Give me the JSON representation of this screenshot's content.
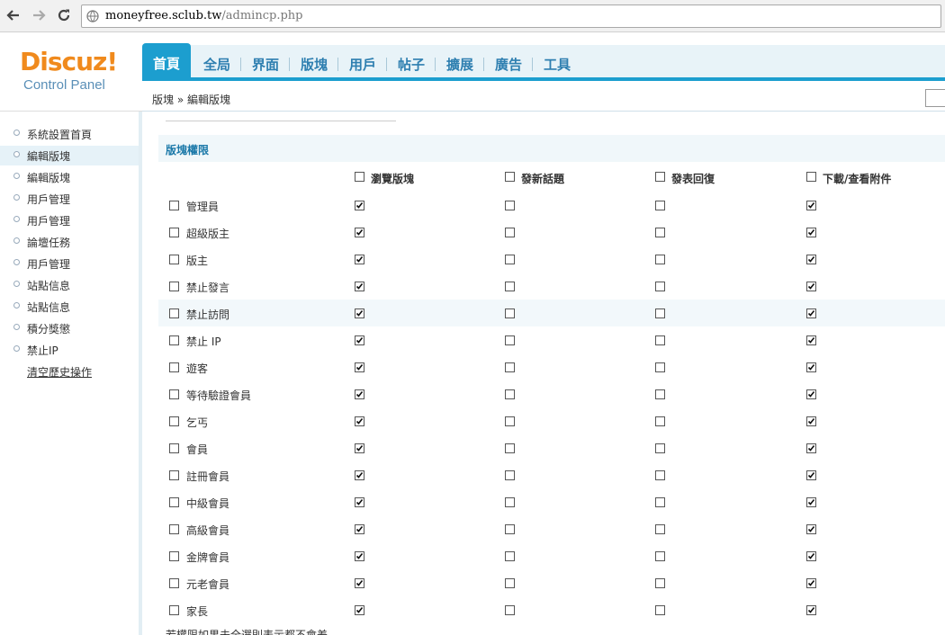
{
  "browser": {
    "url_host": "moneyfree.sclub.tw",
    "url_path": "/admincp.php"
  },
  "logo": {
    "brand": "Discuz!",
    "subtitle": "Control Panel"
  },
  "topnav": [
    {
      "label": "首頁",
      "active": true
    },
    {
      "label": "全局",
      "active": false
    },
    {
      "label": "界面",
      "active": false
    },
    {
      "label": "版塊",
      "active": false
    },
    {
      "label": "用戶",
      "active": false
    },
    {
      "label": "帖子",
      "active": false
    },
    {
      "label": "擴展",
      "active": false
    },
    {
      "label": "廣告",
      "active": false
    },
    {
      "label": "工具",
      "active": false
    }
  ],
  "breadcrumb": "版塊 » 編輯版塊",
  "sidebar": [
    {
      "label": "系統設置首頁",
      "active": false,
      "link": false
    },
    {
      "label": "編輯版塊",
      "active": true,
      "link": false
    },
    {
      "label": "編輯版塊",
      "active": false,
      "link": false
    },
    {
      "label": "用戶管理",
      "active": false,
      "link": false
    },
    {
      "label": "用戶管理",
      "active": false,
      "link": false
    },
    {
      "label": "論壇任務",
      "active": false,
      "link": false
    },
    {
      "label": "用戶管理",
      "active": false,
      "link": false
    },
    {
      "label": "站點信息",
      "active": false,
      "link": false
    },
    {
      "label": "站點信息",
      "active": false,
      "link": false
    },
    {
      "label": "積分獎懲",
      "active": false,
      "link": false
    },
    {
      "label": "禁止IP",
      "active": false,
      "link": false
    },
    {
      "label": "清空歷史操作",
      "active": false,
      "link": true
    }
  ],
  "section_title": "版塊權限",
  "columns": [
    "瀏覽版塊",
    "發新話題",
    "發表回復",
    "下載/查看附件"
  ],
  "groups": [
    {
      "name": "管理員",
      "perms": [
        true,
        false,
        false,
        true
      ]
    },
    {
      "name": "超級版主",
      "perms": [
        true,
        false,
        false,
        true
      ]
    },
    {
      "name": "版主",
      "perms": [
        true,
        false,
        false,
        true
      ]
    },
    {
      "name": "禁止發言",
      "perms": [
        true,
        false,
        false,
        true
      ]
    },
    {
      "name": "禁止訪問",
      "perms": [
        true,
        false,
        false,
        true
      ]
    },
    {
      "name": "禁止 IP",
      "perms": [
        true,
        false,
        false,
        true
      ]
    },
    {
      "name": "遊客",
      "perms": [
        true,
        false,
        false,
        true
      ]
    },
    {
      "name": "等待驗證會員",
      "perms": [
        true,
        false,
        false,
        true
      ]
    },
    {
      "name": "乞丐",
      "perms": [
        true,
        false,
        false,
        true
      ]
    },
    {
      "name": "會員",
      "perms": [
        true,
        false,
        false,
        true
      ]
    },
    {
      "name": "註冊會員",
      "perms": [
        true,
        false,
        false,
        true
      ]
    },
    {
      "name": "中級會員",
      "perms": [
        true,
        false,
        false,
        true
      ]
    },
    {
      "name": "高級會員",
      "perms": [
        true,
        false,
        false,
        true
      ]
    },
    {
      "name": "金牌會員",
      "perms": [
        true,
        false,
        false,
        true
      ]
    },
    {
      "name": "元老會員",
      "perms": [
        true,
        false,
        false,
        true
      ]
    },
    {
      "name": "家長",
      "perms": [
        true,
        false,
        false,
        true
      ]
    }
  ],
  "hovered_row_index": 4,
  "footnote": "若權限如果未全選則表示都不會差"
}
